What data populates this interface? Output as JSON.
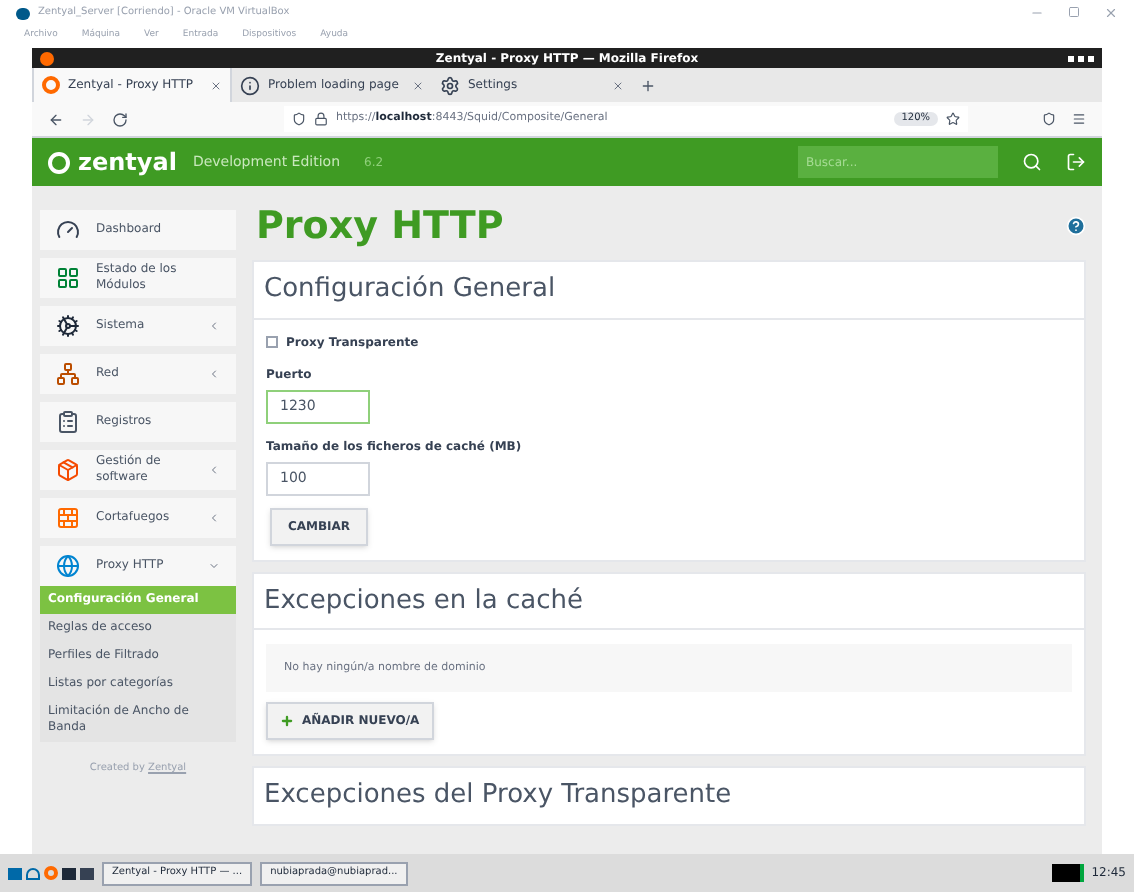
{
  "vbox": {
    "title": "Zentyal_Server [Corriendo] - Oracle VM VirtualBox",
    "menu": [
      "Archivo",
      "Máquina",
      "Ver",
      "Entrada",
      "Dispositivos",
      "Ayuda"
    ]
  },
  "firefox": {
    "title": "Zentyal - Proxy HTTP — Mozilla Firefox",
    "tabs": [
      {
        "label": "Zentyal - Proxy HTTP",
        "selected": true
      },
      {
        "label": "Problem loading page",
        "selected": false
      },
      {
        "label": "Settings",
        "selected": false
      }
    ],
    "url_prefix": "https://",
    "url_host": "localhost",
    "url_rest": ":8443/Squid/Composite/General",
    "zoom": "120%"
  },
  "header": {
    "logo": "zentyal",
    "edition": "Development Edition",
    "version": "6.2",
    "search_placeholder": "Buscar..."
  },
  "sidebar": {
    "items": [
      {
        "label": "Dashboard",
        "kind": "link"
      },
      {
        "label": "Estado de los Módulos",
        "kind": "link"
      },
      {
        "label": "Sistema",
        "kind": "group",
        "expanded": false
      },
      {
        "label": "Red",
        "kind": "group",
        "expanded": false
      },
      {
        "label": "Registros",
        "kind": "link"
      },
      {
        "label": "Gestión de software",
        "kind": "group",
        "expanded": false
      },
      {
        "label": "Cortafuegos",
        "kind": "group",
        "expanded": false
      },
      {
        "label": "Proxy HTTP",
        "kind": "group",
        "expanded": true,
        "children": [
          {
            "label": "Configuración General",
            "selected": true
          },
          {
            "label": "Reglas de acceso",
            "selected": false
          },
          {
            "label": "Perfiles de Filtrado",
            "selected": false
          },
          {
            "label": "Listas por categorías",
            "selected": false
          },
          {
            "label": "Limitación de Ancho de Banda",
            "selected": false
          }
        ]
      }
    ],
    "footer_text": "Created by",
    "footer_link": "Zentyal"
  },
  "page": {
    "title": "Proxy HTTP",
    "general": {
      "heading": "Configuración General",
      "checkbox": {
        "label": "Proxy Transparente",
        "checked": false
      },
      "fields": [
        {
          "label": "Puerto",
          "value": "1230",
          "focused": true
        },
        {
          "label": "Tamaño de los ficheros de caché (MB)",
          "value": "100",
          "focused": false
        }
      ],
      "button": "CAMBIAR"
    },
    "cache_exceptions": {
      "heading": "Excepciones en la caché",
      "empty": "No hay ningún/a nombre de dominio",
      "button": "AÑADIR NUEVO/A"
    },
    "transparent_exceptions": {
      "heading": "Excepciones del Proxy Transparente"
    }
  },
  "taskbar": {
    "windows": [
      "Zentyal - Proxy HTTP — ...",
      "nubiaprada@nubiaprad..."
    ],
    "clock": "12:45"
  }
}
